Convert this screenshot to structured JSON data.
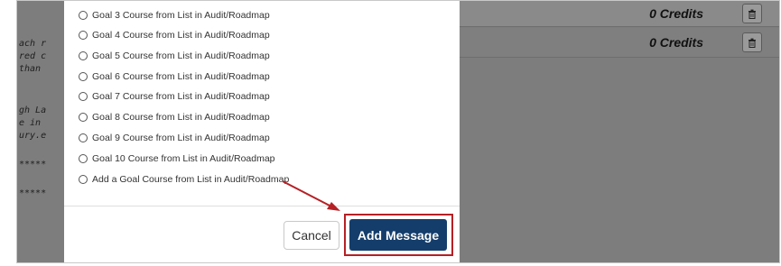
{
  "background": {
    "code_fragments": [
      "ach r",
      "red c",
      "than",
      "gh La",
      "e in",
      "ury.e",
      "*****",
      "*****"
    ],
    "rows": [
      {
        "credits": "0 Credits",
        "delete_icon": "trash-icon"
      },
      {
        "credits": "0 Credits",
        "delete_icon": "trash-icon"
      }
    ]
  },
  "modal": {
    "options": [
      "Goal 3 Course from List in Audit/Roadmap",
      "Goal 4 Course from List in Audit/Roadmap",
      "Goal 5 Course from List in Audit/Roadmap",
      "Goal 6 Course from List in Audit/Roadmap",
      "Goal 7 Course from List in Audit/Roadmap",
      "Goal 8 Course from List in Audit/Roadmap",
      "Goal 9 Course from List in Audit/Roadmap",
      "Goal 10 Course from List in Audit/Roadmap",
      "Add a Goal Course from List in Audit/Roadmap"
    ],
    "cancel_label": "Cancel",
    "add_label": "Add Message"
  },
  "colors": {
    "primary_button": "#143d6b",
    "highlight_annotation": "#b52025",
    "overlay": "#7d7d7d"
  }
}
